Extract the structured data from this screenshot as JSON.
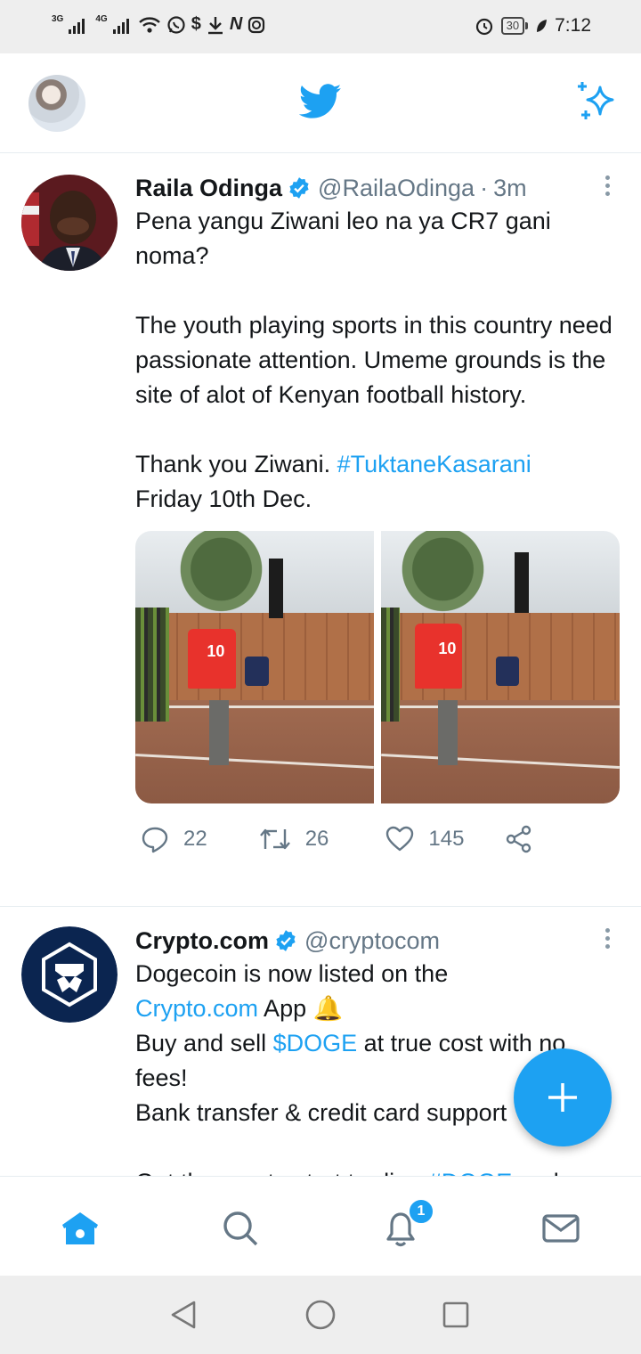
{
  "status_bar": {
    "net1": "3G",
    "net2": "4G",
    "battery": "30",
    "time": "7:12",
    "icons": [
      "signal-icon",
      "wifi-icon",
      "whatsapp-icon",
      "dollar-icon",
      "download-icon",
      "nfc-icon",
      "instagram-icon",
      "alarm-icon",
      "battery-icon",
      "leaf-icon"
    ]
  },
  "header": {
    "logo": "twitter-bird-icon",
    "right_icon": "sparkle-icon"
  },
  "tweets": [
    {
      "name": "Raila Odinga",
      "handle": "@RailaOdinga",
      "separator": "·",
      "time": "3m",
      "p1": "Pena yangu Ziwani leo na ya CR7 gani noma?",
      "p2": "The youth playing sports in this country need passionate attention. Umeme grounds is the site of alot of Kenyan football history.",
      "p3_text": "Thank you Ziwani. ",
      "p3_hashtag": "#TuktaneKasarani",
      "p4": "Friday 10th Dec.",
      "photo1_number": "10",
      "photo2_number": "10",
      "replies": "22",
      "retweets": "26",
      "likes": "145"
    },
    {
      "name": "Crypto.com",
      "handle": "@cryptocom",
      "l1": "Dogecoin is now listed on the",
      "l2_link": "Crypto.com",
      "l2_text": " App ",
      "l2_emoji": "🔔",
      "l3_text1": "Buy and sell ",
      "l3_link": "$DOGE",
      "l3_text2": " at true cost with no fees!",
      "l4": "Bank transfer & credit card support",
      "l5_text": "Get the app to start trading ",
      "l5_link": "#DOGE",
      "l5_text2": " and"
    }
  ],
  "bottom_nav": {
    "items": [
      "home-icon",
      "search-icon",
      "notifications-icon",
      "messages-icon"
    ],
    "notification_badge": "1"
  },
  "colors": {
    "accent": "#1da1f2",
    "text": "#14171a",
    "secondary": "#657786",
    "divider": "#e6ecf0"
  }
}
